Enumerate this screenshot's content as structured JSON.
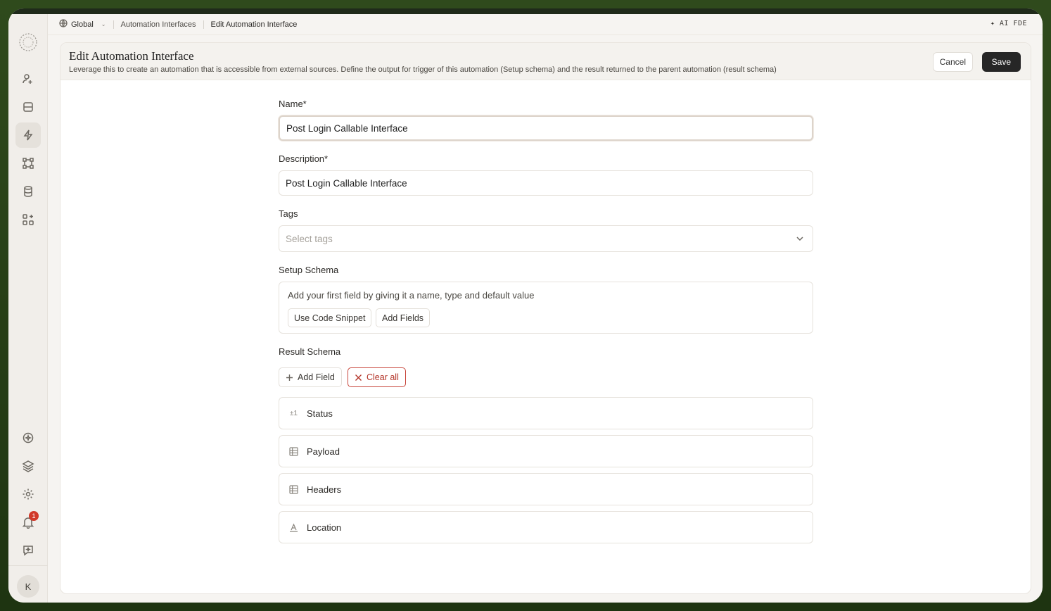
{
  "breadcrumb": {
    "scope": "Global",
    "items": [
      "Automation Interfaces",
      "Edit Automation Interface"
    ]
  },
  "assistant_label": "✦ AI FDE",
  "sidebar": {
    "notification_count": "1",
    "avatar_initial": "K"
  },
  "header": {
    "title": "Edit Automation Interface",
    "description": "Leverage this to create an automation that is accessible from external sources. Define the output for trigger of this automation (Setup schema) and the result returned to the parent automation (result schema)",
    "cancel_label": "Cancel",
    "save_label": "Save"
  },
  "form": {
    "name_label": "Name*",
    "name_value": "Post Login Callable Interface",
    "description_label": "Description*",
    "description_value": "Post Login Callable Interface",
    "tags_label": "Tags",
    "tags_placeholder": "Select tags",
    "setup_schema_label": "Setup Schema",
    "setup_schema_hint": "Add your first field by giving it a name, type and default value",
    "use_code_snippet_label": "Use Code Snippet",
    "add_fields_label": "Add Fields",
    "result_schema_label": "Result Schema",
    "add_field_label": "Add Field",
    "clear_all_label": "Clear all",
    "result_fields": [
      {
        "name": "Status",
        "icon": "number-icon"
      },
      {
        "name": "Payload",
        "icon": "table-icon"
      },
      {
        "name": "Headers",
        "icon": "table-icon"
      },
      {
        "name": "Location",
        "icon": "text-icon"
      }
    ]
  }
}
